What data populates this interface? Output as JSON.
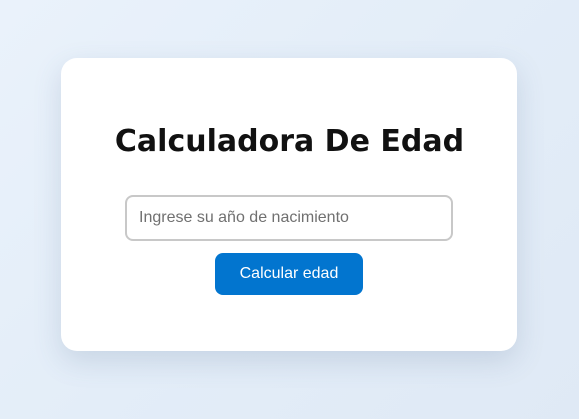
{
  "calculator": {
    "title": "Calculadora De Edad",
    "input_placeholder": "Ingrese su año de nacimiento",
    "input_value": "",
    "button_label": "Calcular edad"
  },
  "colors": {
    "background": "#e6eef8",
    "card": "#ffffff",
    "button": "#0275cf",
    "button_text": "#ffffff",
    "input_border": "#c8c8c8"
  }
}
